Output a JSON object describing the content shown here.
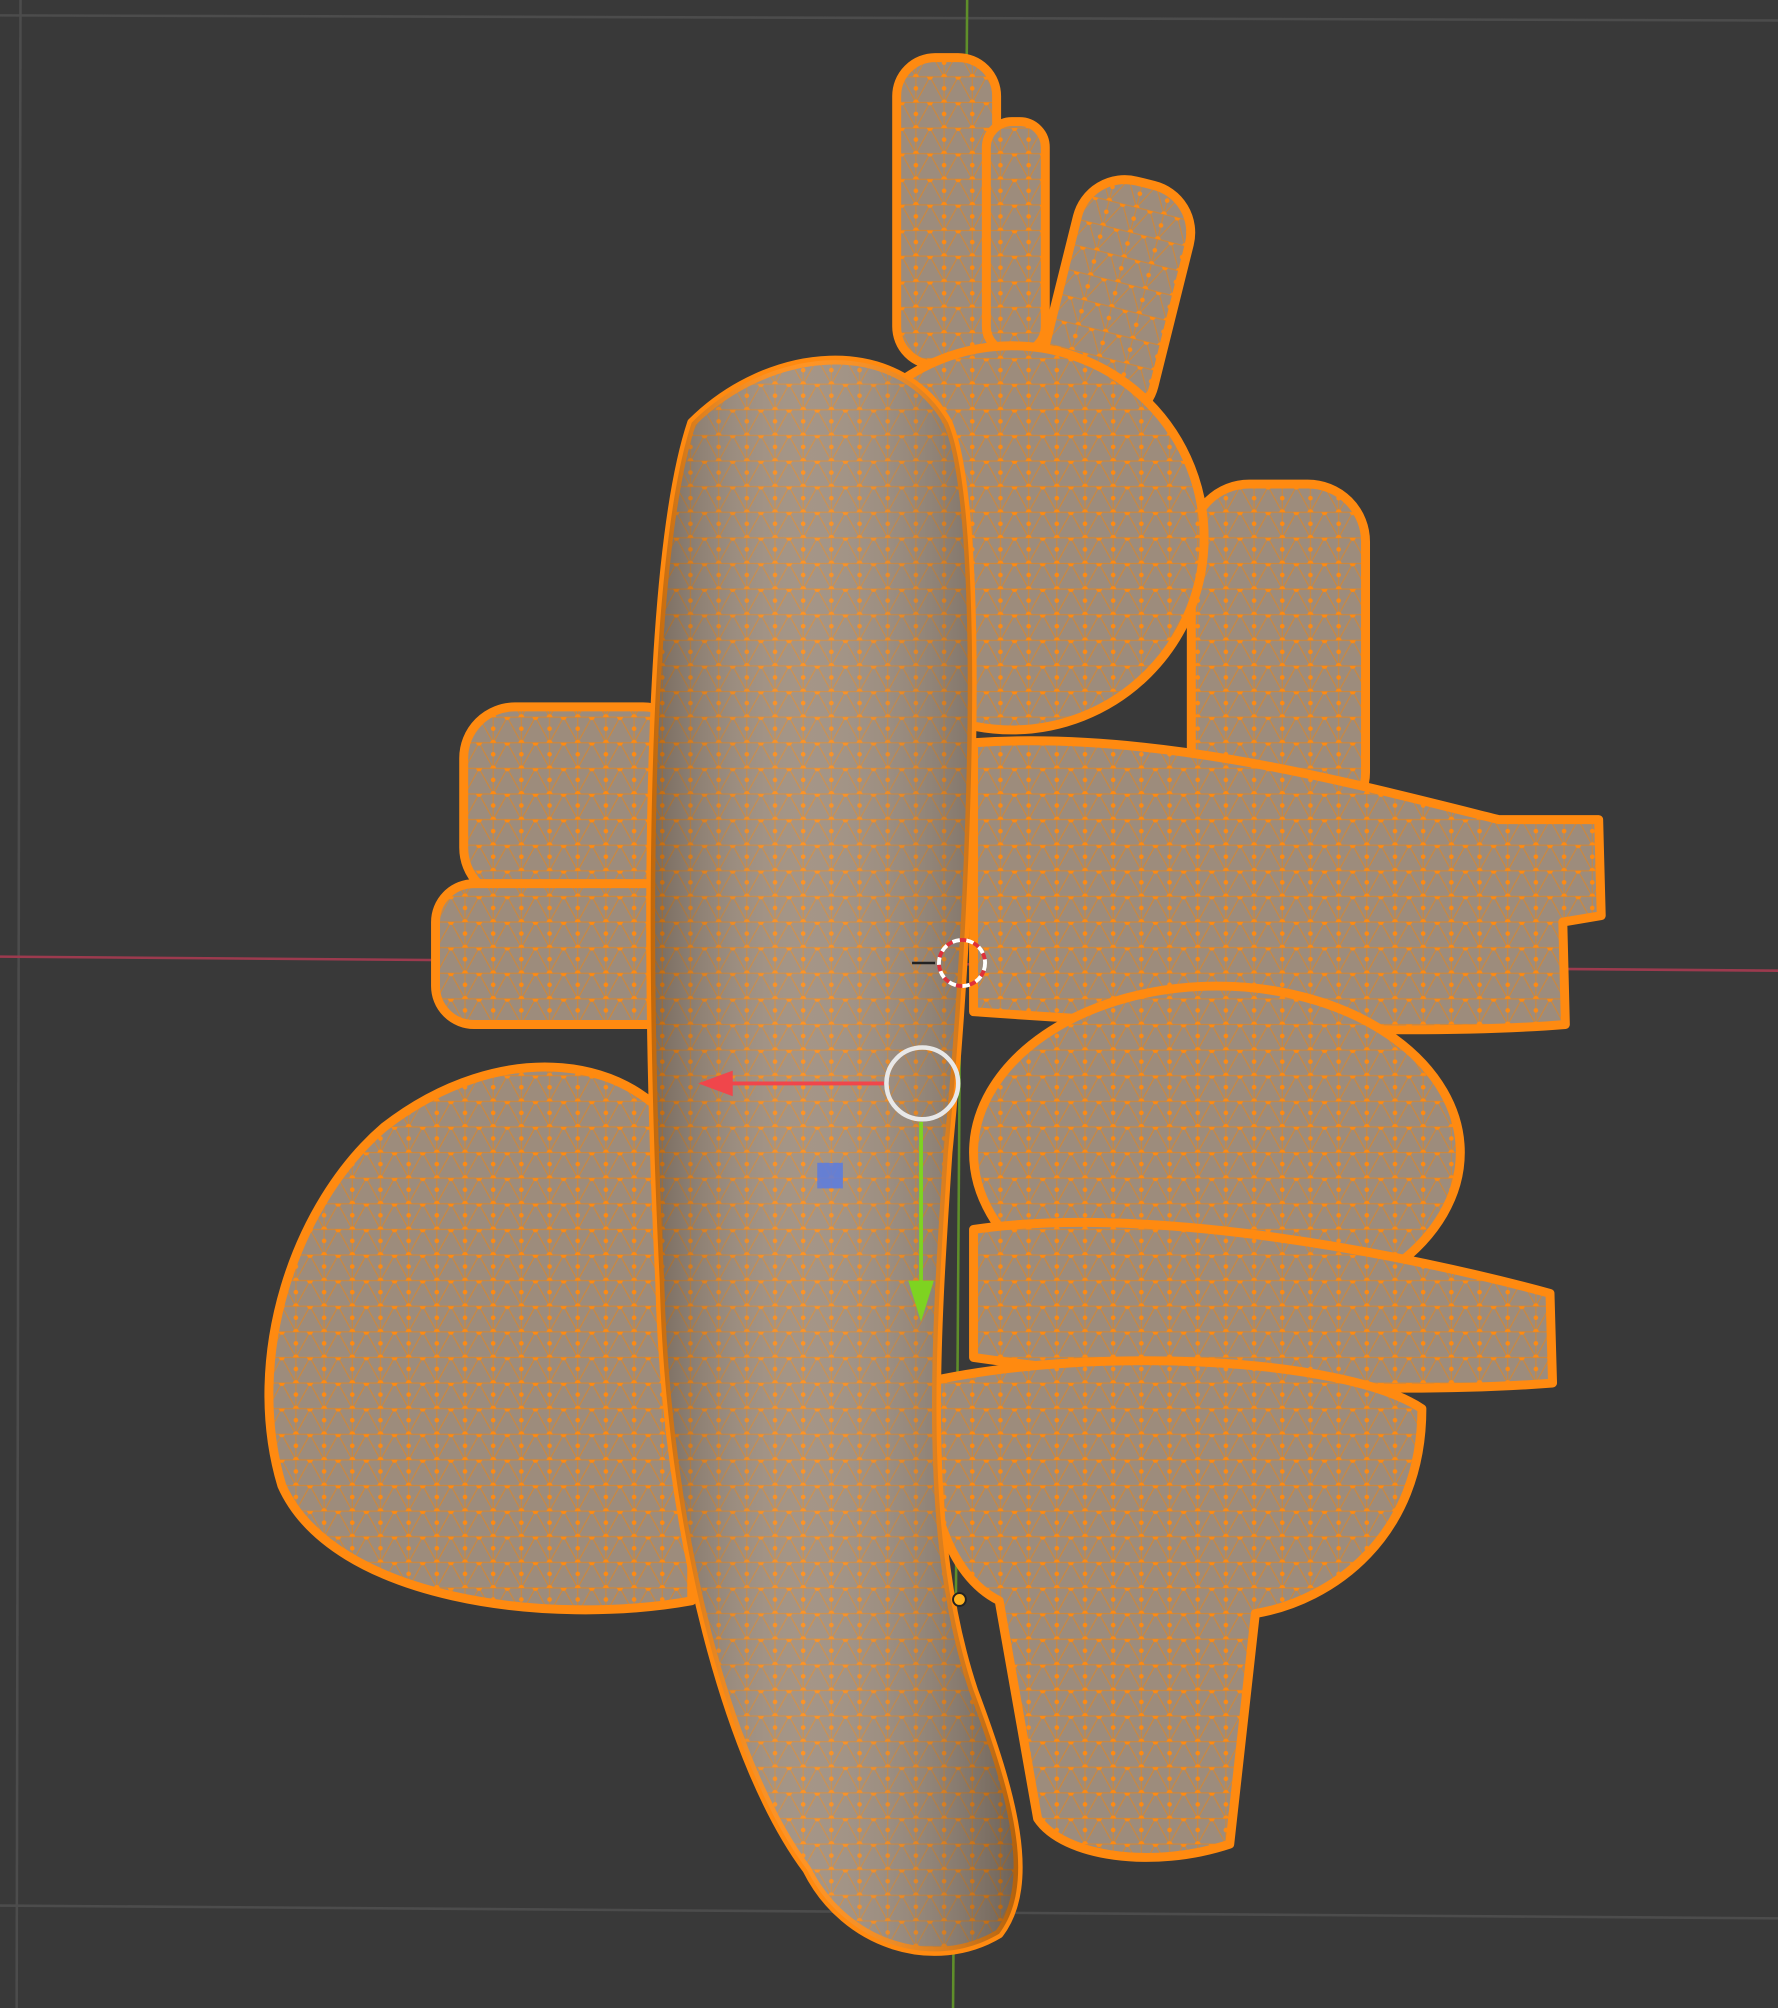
{
  "viewport": {
    "mode": "edit-mode-mesh",
    "background": "#393939",
    "grid_color": "#4a4a4a",
    "x_axis_color": "#9c3a4e",
    "y_axis_color": "#5f8f2a",
    "mesh_fill": "#9a8a7a",
    "mesh_wire": "#ff8a10",
    "gizmo_x_color": "#f0464b",
    "gizmo_y_color": "#7ed321",
    "gizmo_z_color": "#5a7be0",
    "icons": [
      "3d-cursor-icon",
      "transform-gizmo-icon"
    ]
  }
}
